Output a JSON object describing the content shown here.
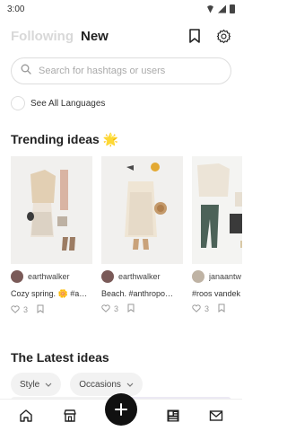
{
  "status": {
    "time": "3:00"
  },
  "header": {
    "tab_following": "Following",
    "tab_new": "New"
  },
  "search": {
    "placeholder": "Search for hashtags or users"
  },
  "language": {
    "label": "See All Languages"
  },
  "trending": {
    "title": "Trending ideas",
    "title_emoji": "🌟",
    "cards": [
      {
        "username": "earthwalker",
        "caption": "Cozy spring. 🌼 #a…",
        "likes": "3"
      },
      {
        "username": "earthwalker",
        "caption": "Beach. #anthropo…",
        "likes": "3"
      },
      {
        "username": "janaantw",
        "caption": "#roos vandek",
        "likes": "3"
      }
    ]
  },
  "latest": {
    "title": "The Latest ideas",
    "chips": [
      {
        "label": "Style"
      },
      {
        "label": "Occasions"
      }
    ]
  },
  "colors": {
    "accent": "#111111",
    "inactive_tab": "#d8d8d8",
    "card_bg": "#f1f0ee"
  }
}
